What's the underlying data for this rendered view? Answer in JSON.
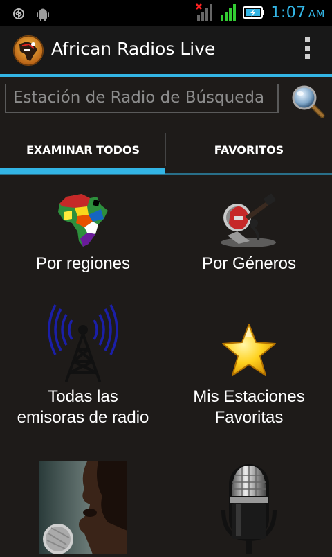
{
  "status_bar": {
    "time": "1:07",
    "ampm": "AM",
    "icons": [
      "sync-icon",
      "android-icon",
      "signal-no-data-icon",
      "signal-icon",
      "battery-charging-icon"
    ]
  },
  "app_bar": {
    "title": "African Radios Live",
    "icon": "app-logo-icon",
    "overflow_icon": "overflow-menu-icon"
  },
  "search": {
    "placeholder": "Estación de Radio de Búsqueda",
    "button_icon": "search-icon"
  },
  "tabs": [
    {
      "label": "EXAMINAR TODOS",
      "selected": true
    },
    {
      "label": "FAVORITOS",
      "selected": false
    }
  ],
  "grid": [
    {
      "label": "Por regiones",
      "icon": "africa-map-icon"
    },
    {
      "label": "Por Géneros",
      "icon": "guitar-icon"
    },
    {
      "label_line1": "Todas las",
      "label_line2": "emisoras de radio",
      "icon": "radio-tower-icon"
    },
    {
      "label_line1": "Mis Estaciones",
      "label_line2": "Favoritas",
      "icon": "star-icon"
    },
    {
      "icon": "singer-photo"
    },
    {
      "icon": "microphone-icon"
    }
  ],
  "colors": {
    "accent": "#33b5e5",
    "background": "#1e1b19",
    "action_bar": "#181818"
  }
}
